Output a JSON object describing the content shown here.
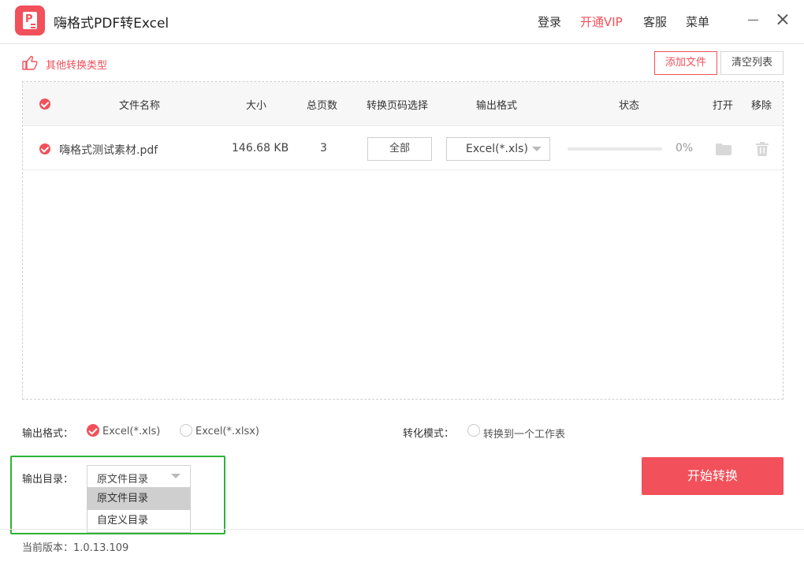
{
  "app": {
    "title": "嗨格式PDF转Excel"
  },
  "menu": {
    "login": "登录",
    "vip": "开通VIP",
    "service": "客服",
    "menu": "菜单"
  },
  "toolbar": {
    "other_types": "其他转换类型",
    "add_file": "添加文件",
    "clear_list": "清空列表"
  },
  "table": {
    "headers": {
      "name": "文件名称",
      "size": "大小",
      "pages": "总页数",
      "page_select": "转换页码选择",
      "format": "输出格式",
      "status": "状态",
      "open": "打开",
      "remove": "移除"
    },
    "rows": [
      {
        "name": "嗨格式测试素材.pdf",
        "size": "146.68 KB",
        "pages": "3",
        "page_select": "全部",
        "format": "Excel(*.xls)",
        "progress": 0,
        "progress_label": "0%",
        "checked": true
      }
    ]
  },
  "options": {
    "format_label": "输出格式：",
    "format_xls": "Excel(*.xls)",
    "format_xlsx": "Excel(*.xlsx)",
    "format_selected": "Excel(*.xls)",
    "mode_label": "转化模式：",
    "mode_option": "转换到一个工作表",
    "mode_checked": false
  },
  "output_dir": {
    "label": "输出目录：",
    "selected": "原文件目录",
    "options": [
      "原文件目录",
      "自定义目录"
    ]
  },
  "start_button": "开始转换",
  "version": "当前版本：1.0.13.109",
  "colors": {
    "accent": "#f2505a",
    "highlight": "#2db335"
  },
  "icons": [
    "app-logo-icon",
    "hand-point-icon",
    "check-icon",
    "chevron-down-icon",
    "folder-icon",
    "trash-icon",
    "minimize-icon",
    "close-icon"
  ]
}
